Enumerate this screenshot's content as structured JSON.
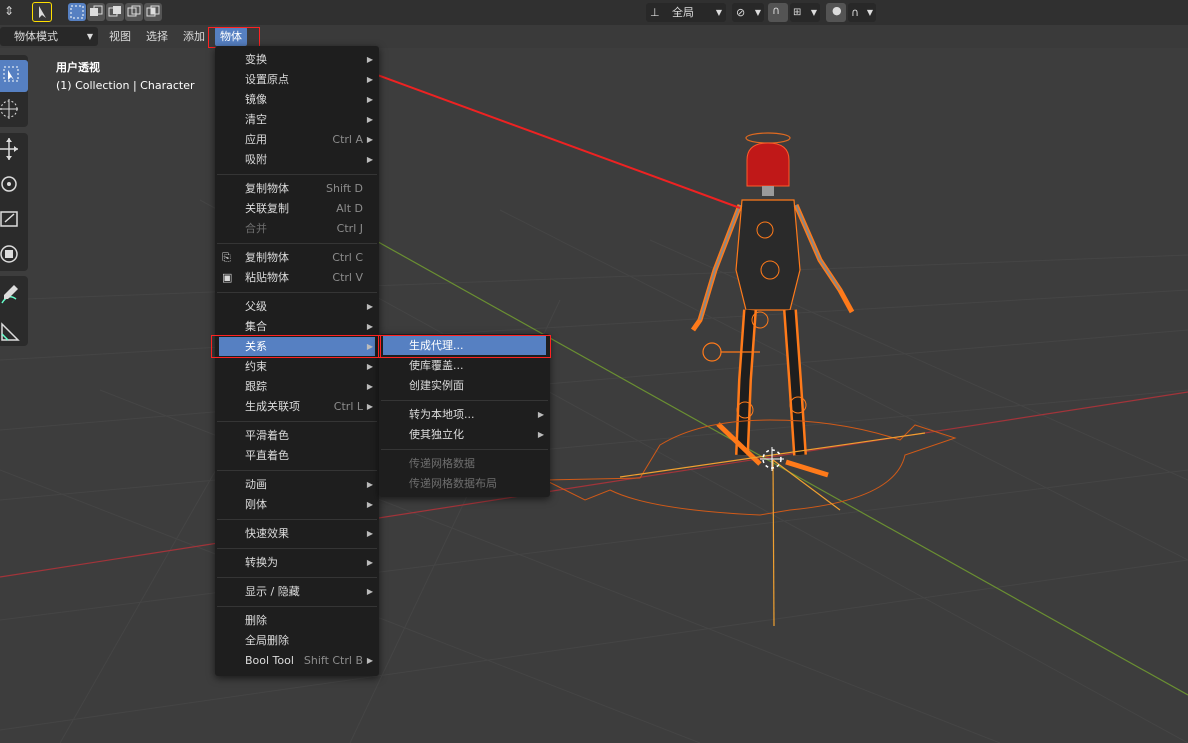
{
  "header": {
    "orientation_label": "全局",
    "mode_label": "物体模式",
    "menus": [
      "视图",
      "选择",
      "添加",
      "物体"
    ]
  },
  "viewport": {
    "view_name": "用户透视",
    "collection_info": "(1) Collection | Character"
  },
  "object_menu": {
    "groups": [
      [
        {
          "label": "变换",
          "shortcut": "",
          "submenu": true
        },
        {
          "label": "设置原点",
          "shortcut": "",
          "submenu": true
        },
        {
          "label": "镜像",
          "shortcut": "",
          "submenu": true
        },
        {
          "label": "清空",
          "shortcut": "",
          "submenu": true
        },
        {
          "label": "应用",
          "shortcut": "Ctrl A",
          "submenu": true
        },
        {
          "label": "吸附",
          "shortcut": "",
          "submenu": true
        }
      ],
      [
        {
          "label": "复制物体",
          "shortcut": "Shift D",
          "submenu": false
        },
        {
          "label": "关联复制",
          "shortcut": "Alt D",
          "submenu": false
        },
        {
          "label": "合并",
          "shortcut": "Ctrl J",
          "submenu": false,
          "disabled": true
        }
      ],
      [
        {
          "label": "复制物体",
          "shortcut": "Ctrl C",
          "submenu": false
        },
        {
          "label": "粘贴物体",
          "shortcut": "Ctrl V",
          "submenu": false
        }
      ],
      [
        {
          "label": "父级",
          "shortcut": "",
          "submenu": true
        },
        {
          "label": "集合",
          "shortcut": "",
          "submenu": true
        },
        {
          "label": "关系",
          "shortcut": "",
          "submenu": true,
          "highlighted": true
        },
        {
          "label": "约束",
          "shortcut": "",
          "submenu": true
        },
        {
          "label": "跟踪",
          "shortcut": "",
          "submenu": true
        },
        {
          "label": "生成关联项",
          "shortcut": "Ctrl L",
          "submenu": true
        }
      ],
      [
        {
          "label": "平滑着色",
          "shortcut": "",
          "submenu": false
        },
        {
          "label": "平直着色",
          "shortcut": "",
          "submenu": false
        }
      ],
      [
        {
          "label": "动画",
          "shortcut": "",
          "submenu": true
        },
        {
          "label": "刚体",
          "shortcut": "",
          "submenu": true
        }
      ],
      [
        {
          "label": "快速效果",
          "shortcut": "",
          "submenu": true
        }
      ],
      [
        {
          "label": "转换为",
          "shortcut": "",
          "submenu": true
        }
      ],
      [
        {
          "label": "显示 / 隐藏",
          "shortcut": "",
          "submenu": true
        }
      ],
      [
        {
          "label": "删除",
          "shortcut": "",
          "submenu": false
        },
        {
          "label": "全局删除",
          "shortcut": "",
          "submenu": false
        },
        {
          "label": "Bool Tool",
          "shortcut": "Shift Ctrl B",
          "submenu": true
        }
      ]
    ]
  },
  "relations_submenu": {
    "groups": [
      [
        {
          "label": "生成代理...",
          "submenu": false,
          "highlighted": true
        },
        {
          "label": "使库覆盖...",
          "submenu": false
        },
        {
          "label": "创建实例面",
          "submenu": false
        }
      ],
      [
        {
          "label": "转为本地项...",
          "submenu": true
        },
        {
          "label": "使其独立化",
          "submenu": true
        }
      ],
      [
        {
          "label": "传递网格数据",
          "submenu": false,
          "disabled": true
        },
        {
          "label": "传递网格数据布局",
          "submenu": false,
          "disabled": true
        }
      ]
    ]
  },
  "colors": {
    "accent": "#5680c2",
    "annotation": "#ff2222",
    "selection": "#ff7a1a",
    "menu_bg": "#1e1e1e",
    "viewport_bg": "#3d3d3d"
  }
}
